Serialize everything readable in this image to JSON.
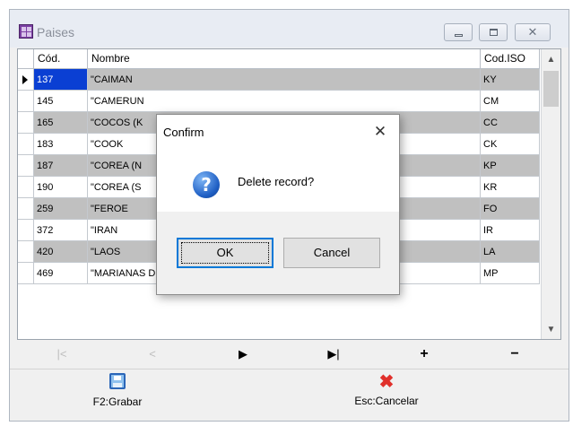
{
  "window": {
    "title": "Paises",
    "icon": "app-grid-icon",
    "controls": {
      "minimize": "minimize-icon",
      "maximize": "maximize-icon",
      "close": "close-icon"
    }
  },
  "grid": {
    "columns": [
      "Cód.",
      "Nombre",
      "Cod.ISO"
    ],
    "rows": [
      {
        "cod": "137",
        "nombre": "\"CAIMAN",
        "iso": "KY",
        "selected": true
      },
      {
        "cod": "145",
        "nombre": "\"CAMERUN",
        "iso": "CM"
      },
      {
        "cod": "165",
        "nombre": "\"COCOS (K",
        "iso": "CC"
      },
      {
        "cod": "183",
        "nombre": "\"COOK",
        "iso": "CK"
      },
      {
        "cod": "187",
        "nombre": "\"COREA (N",
        "iso": "KP"
      },
      {
        "cod": "190",
        "nombre": "\"COREA (S",
        "iso": "KR"
      },
      {
        "cod": "259",
        "nombre": "\"FEROE",
        "iso": "FO"
      },
      {
        "cod": "372",
        "nombre": "\"IRAN",
        "iso": "IR"
      },
      {
        "cod": "420",
        "nombre": "\"LAOS",
        "iso": "LA"
      },
      {
        "cod": "469",
        "nombre": "\"MARIANAS DEL NORTE",
        "iso": "MP"
      }
    ],
    "selected_color": "#0a3fd3",
    "alt_row_color": "#c0c0c0"
  },
  "navigator": {
    "first": "|<",
    "prior": "<",
    "next": "▶",
    "last": "▶|",
    "insert": "+",
    "delete": "−"
  },
  "actions": {
    "save_label": "F2:Grabar",
    "cancel_label": "Esc:Cancelar"
  },
  "dialog": {
    "title": "Confirm",
    "close_glyph": "✕",
    "icon_glyph": "?",
    "message": "Delete record?",
    "ok_label": "OK",
    "cancel_label": "Cancel"
  }
}
